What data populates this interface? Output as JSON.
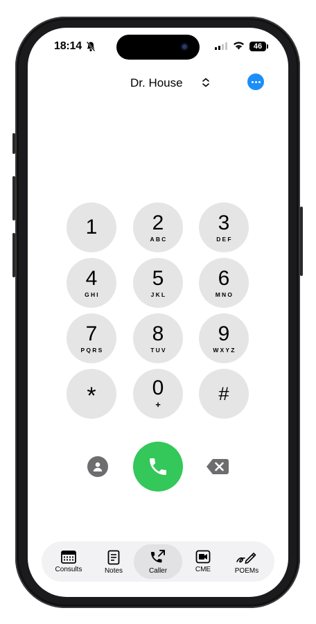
{
  "status_bar": {
    "time": "18:14",
    "battery": "46"
  },
  "header": {
    "title": "Dr. House"
  },
  "keypad": [
    {
      "digit": "1",
      "letters": ""
    },
    {
      "digit": "2",
      "letters": "ABC"
    },
    {
      "digit": "3",
      "letters": "DEF"
    },
    {
      "digit": "4",
      "letters": "GHI"
    },
    {
      "digit": "5",
      "letters": "JKL"
    },
    {
      "digit": "6",
      "letters": "MNO"
    },
    {
      "digit": "7",
      "letters": "PQRS"
    },
    {
      "digit": "8",
      "letters": "TUV"
    },
    {
      "digit": "9",
      "letters": "WXYZ"
    },
    {
      "digit": "*",
      "letters": ""
    },
    {
      "digit": "0",
      "letters": "+"
    },
    {
      "digit": "#",
      "letters": ""
    }
  ],
  "tabbar": {
    "active": "Caller",
    "tabs": [
      {
        "label": "Consults",
        "icon": "calendar-icon"
      },
      {
        "label": "Notes",
        "icon": "note-icon"
      },
      {
        "label": "Caller",
        "icon": "phone-outgoing-icon"
      },
      {
        "label": "CME",
        "icon": "video-icon"
      },
      {
        "label": "POEMs",
        "icon": "pen-icon"
      }
    ]
  },
  "colors": {
    "accent": "#1c8ef9",
    "call_green": "#34c75a",
    "key_gray": "#e5e5e6"
  }
}
